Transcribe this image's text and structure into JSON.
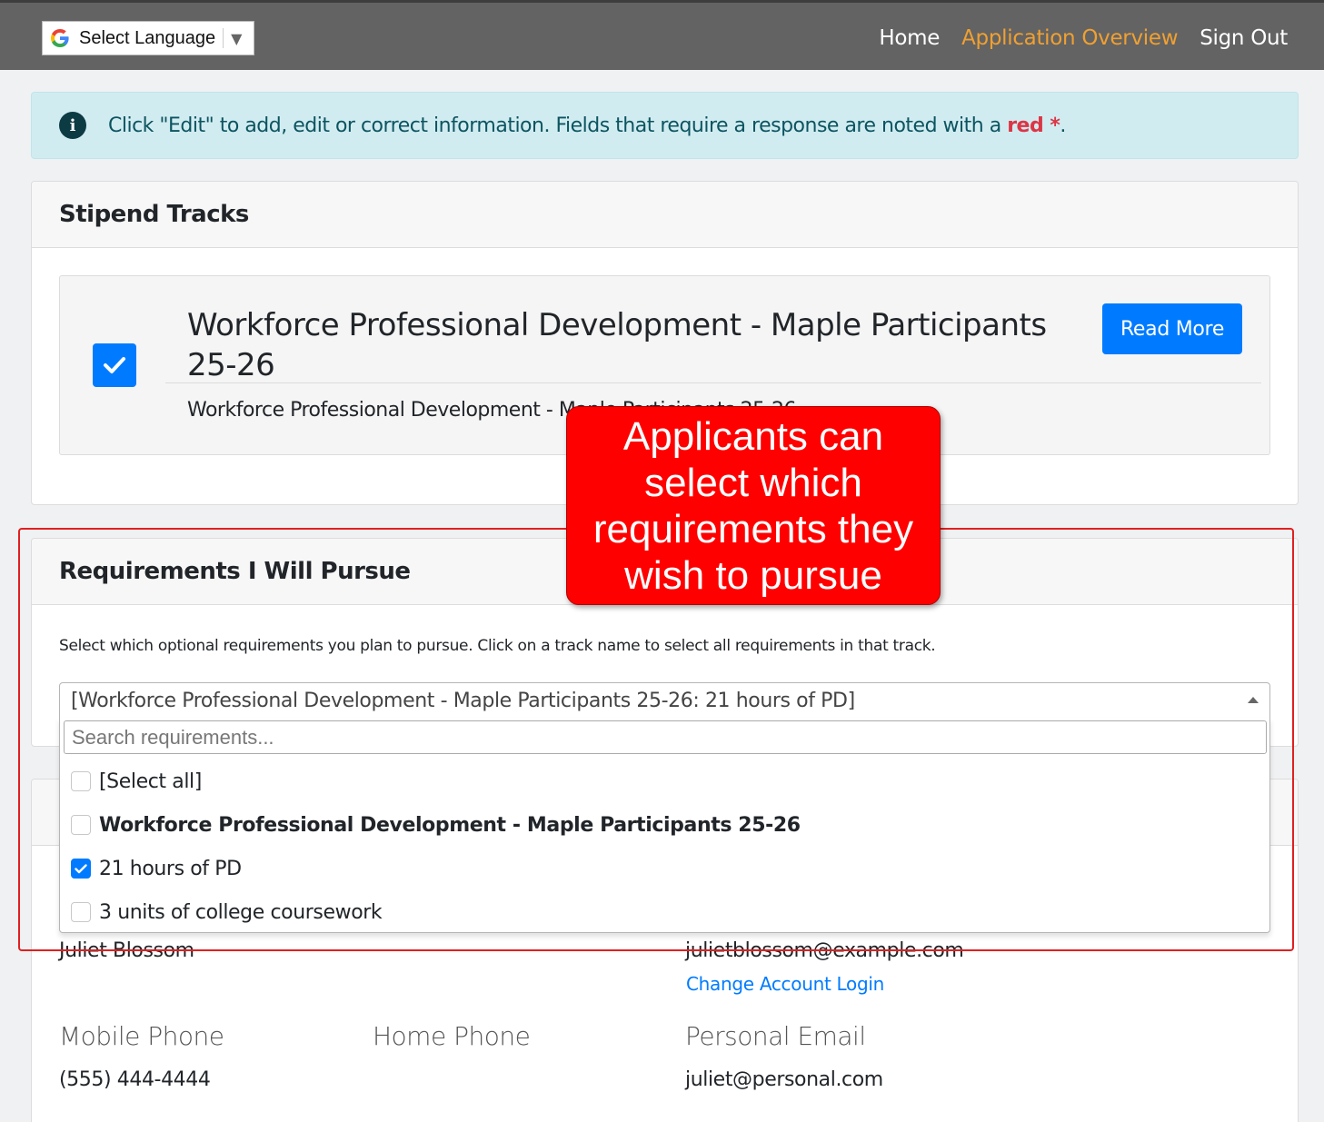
{
  "topbar": {
    "language_label": "Select Language",
    "language_arrow": "▼",
    "nav": [
      {
        "label": "Home",
        "active": false
      },
      {
        "label": "Application Overview",
        "active": true
      },
      {
        "label": "Sign Out",
        "active": false
      }
    ],
    "active_color": "#f0a031"
  },
  "alert": {
    "icon": "info-icon",
    "text_before": "Click \"Edit\" to add, edit or correct information. Fields that require a response are noted with a ",
    "red_text": "red *",
    "text_after": "."
  },
  "stipend": {
    "title": "Stipend Tracks",
    "track_title": "Workforce Professional Development - Maple Participants 25-26",
    "track_sub": "Workforce Professional Development - Maple Participants 25-26",
    "checked": true,
    "read_more": "Read More"
  },
  "requirements": {
    "title": "Requirements I Will Pursue",
    "help": "Select which optional requirements you plan to pursue. Click on a track name to select all requirements in that track.",
    "selected_value": "[Workforce Professional Development - Maple Participants 25-26: 21 hours of PD]",
    "search_placeholder": "Search requirements...",
    "options": [
      {
        "label": "[Select all]",
        "checked": false,
        "bold": false
      },
      {
        "label": "Workforce Professional Development - Maple Participants 25-26",
        "checked": false,
        "bold": true
      },
      {
        "label": "21 hours of PD",
        "checked": true,
        "bold": false
      },
      {
        "label": "3 units of college coursework",
        "checked": false,
        "bold": false
      }
    ]
  },
  "contact": {
    "name_value": "Juliet Blossom",
    "login_email": "julietblossom@example.com",
    "change_login": "Change Account Login",
    "mobile_label": "Mobile Phone",
    "mobile_value": "(555) 444-4444",
    "home_label": "Home Phone",
    "personal_email_label": "Personal Email",
    "personal_email_value": "juliet@personal.com"
  },
  "callout": {
    "text": "Applicants can select which requirements they wish to pursue"
  },
  "colors": {
    "primary": "#007bff",
    "callout": "#fe0000",
    "highlight_border": "#e02020"
  }
}
